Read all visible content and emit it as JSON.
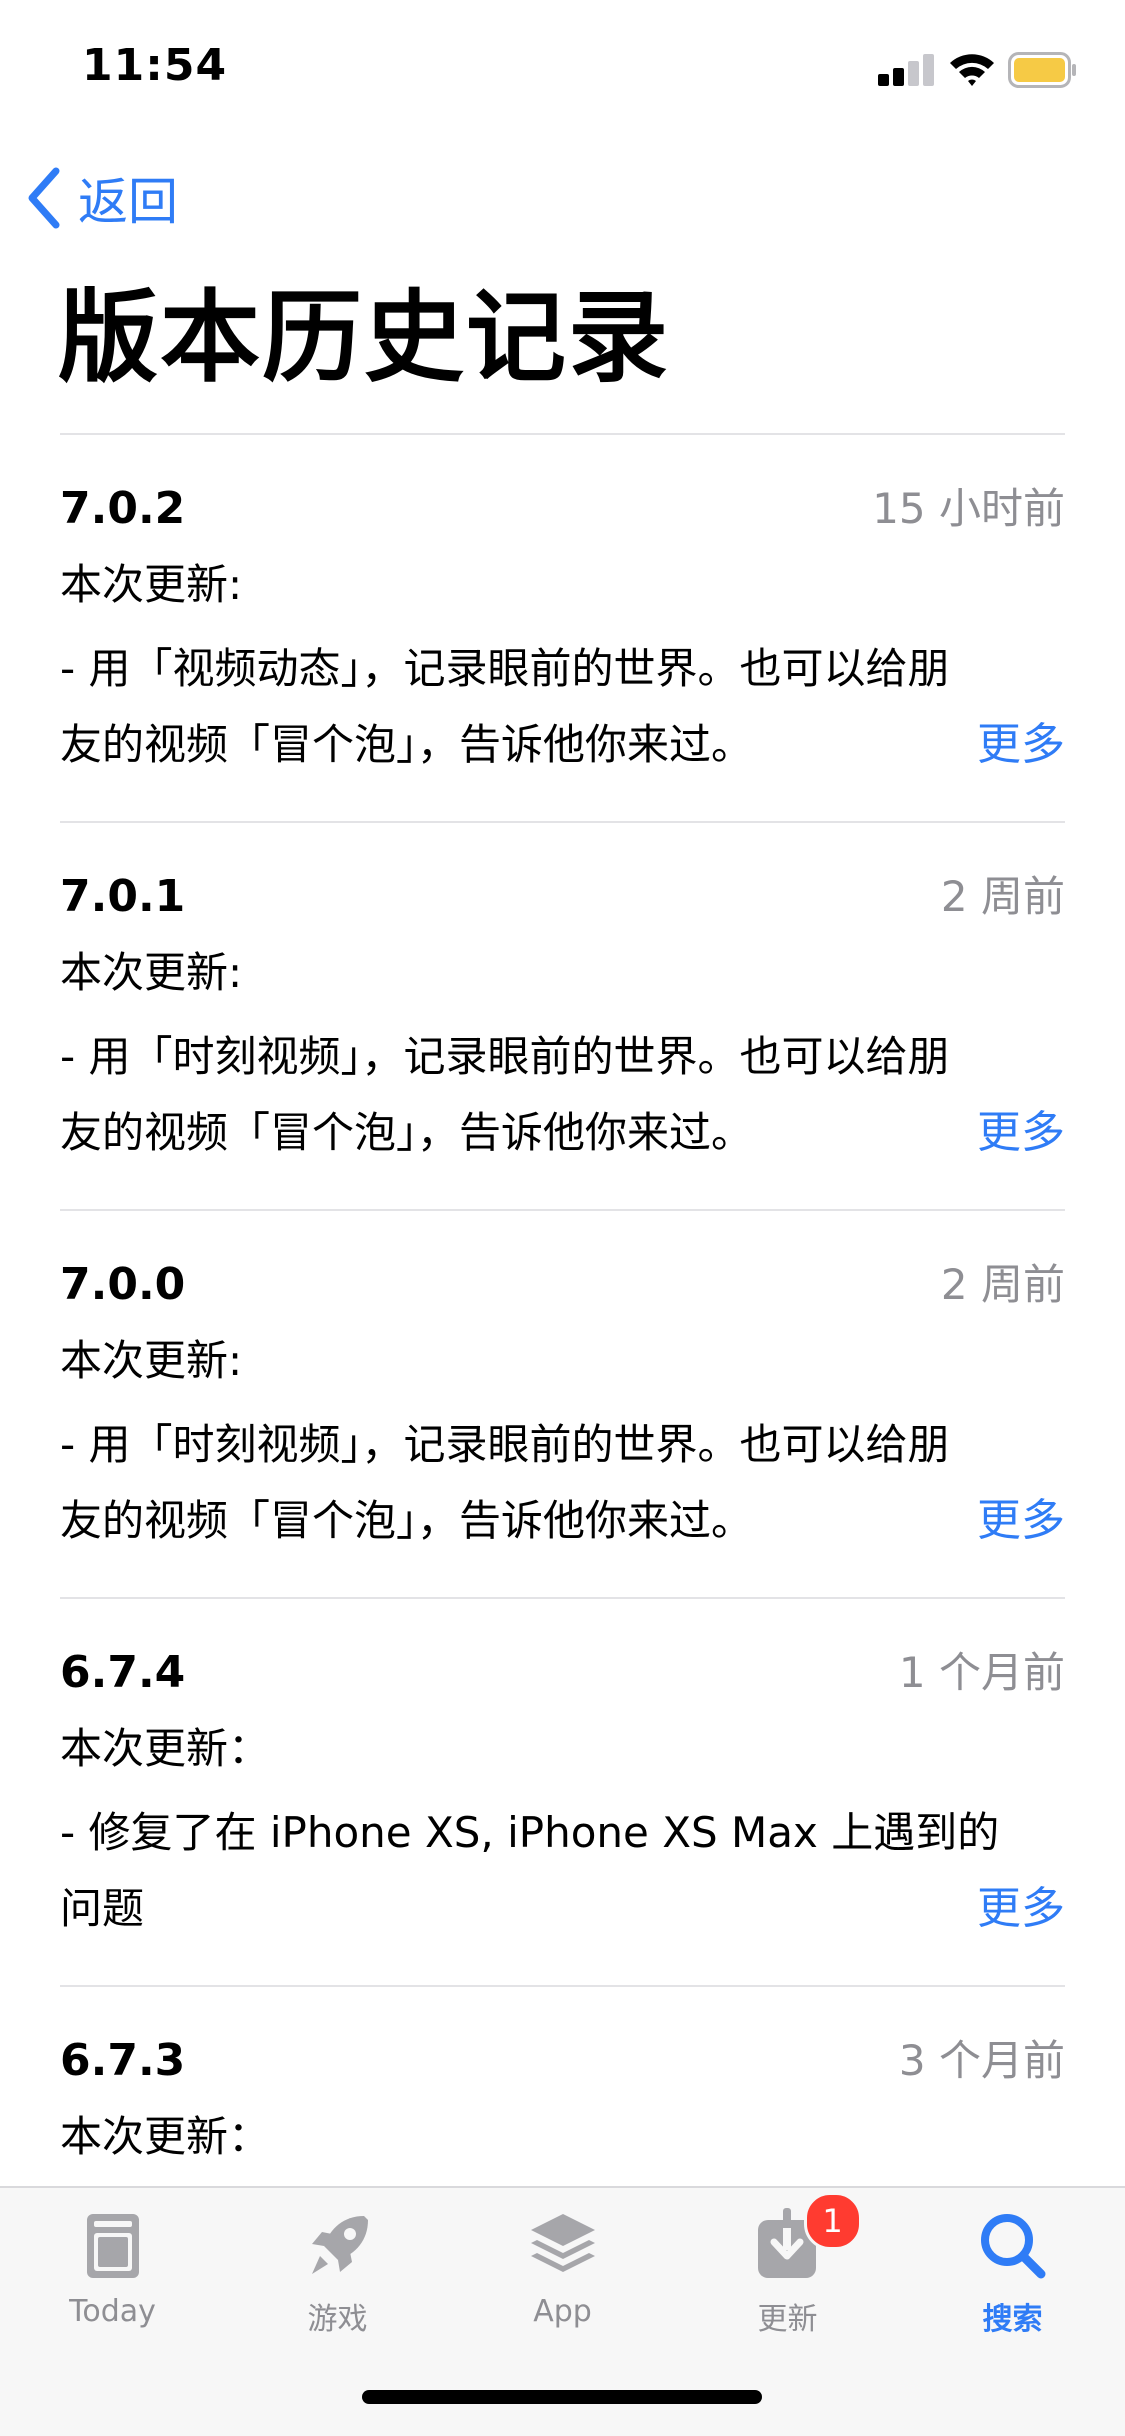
{
  "status_bar": {
    "time": "11:54"
  },
  "nav": {
    "back_label": "返回",
    "title": "版本历史记录"
  },
  "versions": [
    {
      "number": "7.0.2",
      "date": "15 小时前",
      "heading": "本次更新:",
      "notes_line1": "- 用「视频动态」，记录眼前的世界。也可以给朋",
      "notes_line2": "友的视频「冒个泡」，告诉他你来过。",
      "more": "更多"
    },
    {
      "number": "7.0.1",
      "date": "2 周前",
      "heading": "本次更新:",
      "notes_line1": "- 用「时刻视频」，记录眼前的世界。也可以给朋",
      "notes_line2": "友的视频「冒个泡」，告诉他你来过。",
      "more": "更多"
    },
    {
      "number": "7.0.0",
      "date": "2 周前",
      "heading": "本次更新:",
      "notes_line1": "- 用「时刻视频」，记录眼前的世界。也可以给朋",
      "notes_line2": "友的视频「冒个泡」，告诉他你来过。",
      "more": "更多"
    },
    {
      "number": "6.7.4",
      "date": "1 个月前",
      "heading": "本次更新：",
      "notes_line1": "- 修复了在 iPhone XS, iPhone XS Max 上遇到的",
      "notes_line2": "问题",
      "more": "更多"
    },
    {
      "number": "6.7.3",
      "date": "3 个月前",
      "heading": "本次更新：",
      "notes_line1": "",
      "notes_line2": "",
      "more": ""
    }
  ],
  "tab_bar": {
    "tabs": [
      {
        "label": "Today",
        "icon": "today-icon",
        "active": false
      },
      {
        "label": "游戏",
        "icon": "rocket-icon",
        "active": false
      },
      {
        "label": "App",
        "icon": "layers-icon",
        "active": false
      },
      {
        "label": "更新",
        "icon": "download-icon",
        "active": false,
        "badge": "1"
      },
      {
        "label": "搜索",
        "icon": "search-icon",
        "active": true
      }
    ]
  },
  "colors": {
    "accent": "#2f7cf6",
    "secondary_text": "#8e8e93",
    "badge": "#ff3b30",
    "battery": "#f6ca45"
  }
}
